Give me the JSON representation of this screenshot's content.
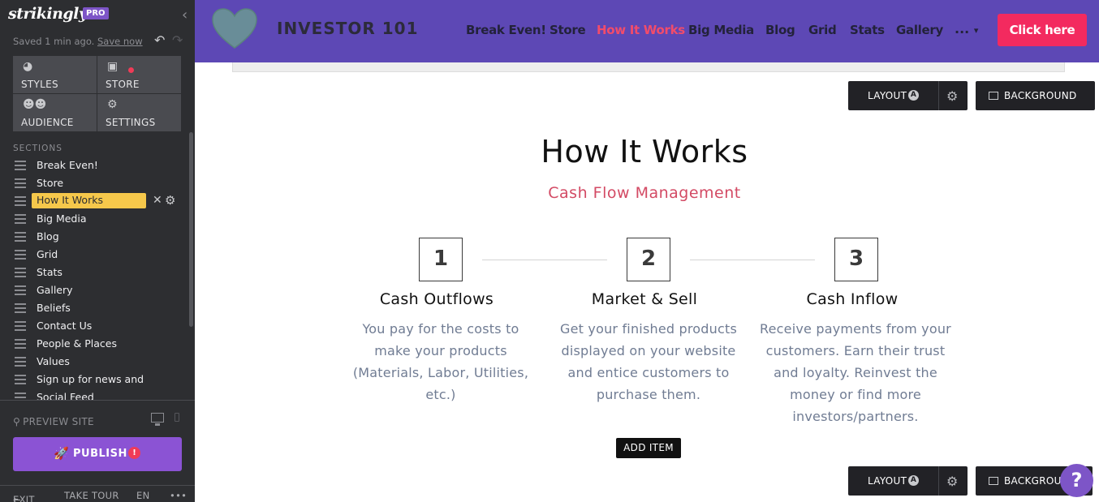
{
  "sidebar": {
    "logo": "strikingly",
    "pro_badge": "PRO",
    "saved_text": "Saved 1 min ago.",
    "save_now": "Save now",
    "tiles": [
      {
        "label": "STYLES",
        "icon": "palette-icon"
      },
      {
        "label": "STORE",
        "icon": "shopping-bag-icon"
      },
      {
        "label": "AUDIENCE",
        "icon": "people-icon"
      },
      {
        "label": "SETTINGS",
        "icon": "gear-icon"
      }
    ],
    "sections_label": "SECTIONS",
    "sections": [
      "Break Even!",
      "Store",
      "How It Works",
      "Big Media",
      "Blog",
      "Grid",
      "Stats",
      "Gallery",
      "Beliefs",
      "Contact Us",
      "People & Places",
      "Values",
      "Sign up for news and",
      "Social Feed"
    ],
    "active_section": "How It Works",
    "preview_label": "PREVIEW SITE",
    "publish_label": "PUBLISH",
    "publish_warning": "!",
    "bottom": {
      "exit": "EXIT",
      "tour": "TAKE TOUR",
      "lang": "EN",
      "more": "•••"
    }
  },
  "topnav": {
    "site_title": "INVESTOR 101",
    "links": [
      "Break Even!",
      "Store",
      "How It Works",
      "Big Media",
      "Blog",
      "Grid",
      "Stats",
      "Gallery"
    ],
    "active_link": "How It Works",
    "more_label": "...",
    "cta_label": "Click here",
    "colors": {
      "bg": "#5d48b5",
      "active": "#f24c6a",
      "cta": "#f32a5f"
    }
  },
  "main": {
    "layout_label": "LAYOUT",
    "layout_badge": "A",
    "background_label": "BACKGROUND",
    "title": "How It Works",
    "subtitle": "Cash Flow Management",
    "steps": [
      {
        "number": "1",
        "title": "Cash Outflows",
        "desc": "You pay for the costs to make your products (Materials, Labor, Utilities, etc.)"
      },
      {
        "number": "2",
        "title": "Market & Sell",
        "desc": "Get your finished products displayed on your website and entice customers to purchase them."
      },
      {
        "number": "3",
        "title": "Cash Inflow",
        "desc": "Receive payments from your customers. Earn their trust and loyalty. Reinvest the money or find more investors/partners."
      }
    ],
    "add_item_label": "ADD ITEM",
    "help_label": "?"
  }
}
